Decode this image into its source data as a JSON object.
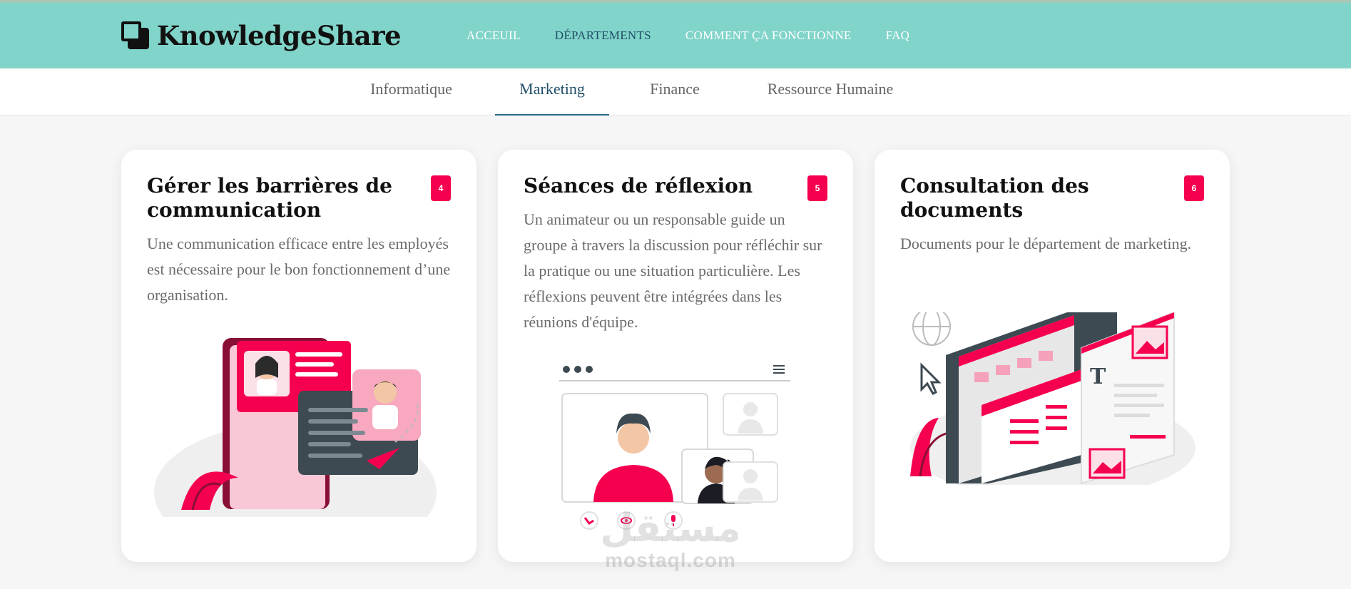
{
  "header": {
    "logo_text": "KnowledgeShare",
    "nav": [
      {
        "label": "ACCEUIL",
        "active": false
      },
      {
        "label": "DÉPARTEMENTS",
        "active": true
      },
      {
        "label": "COMMENT ÇA FONCTIONNE",
        "active": false
      },
      {
        "label": "FAQ",
        "active": false
      }
    ]
  },
  "tabs": [
    {
      "label": "Informatique",
      "active": false
    },
    {
      "label": "Marketing",
      "active": true
    },
    {
      "label": "Finance",
      "active": false
    },
    {
      "label": "Ressource Humaine",
      "active": false
    }
  ],
  "cards": [
    {
      "title": "Gérer les barrières de communication",
      "badge": "4",
      "text": "Une communication efficace entre les employés est nécessaire pour le bon fonctionnement d’une organisation.",
      "illustration": "chat-illustration"
    },
    {
      "title": "Séances de réflexion",
      "badge": "5",
      "text": "Un animateur ou un responsable guide un groupe à travers la discussion pour réfléchir sur la pratique ou une situation particulière. Les réflexions peuvent être intégrées dans les réunions d'équipe.",
      "illustration": "video-call-illustration"
    },
    {
      "title": "Consultation des documents",
      "badge": "6",
      "text": "Documents pour le département de marketing.",
      "illustration": "documents-illustration"
    }
  ],
  "watermark": {
    "arabic": "مستقل",
    "latin": "mostaql.com"
  },
  "colors": {
    "header_bg": "#81d4c9",
    "accent": "#f5004f",
    "active_nav": "#1f4e6a"
  }
}
